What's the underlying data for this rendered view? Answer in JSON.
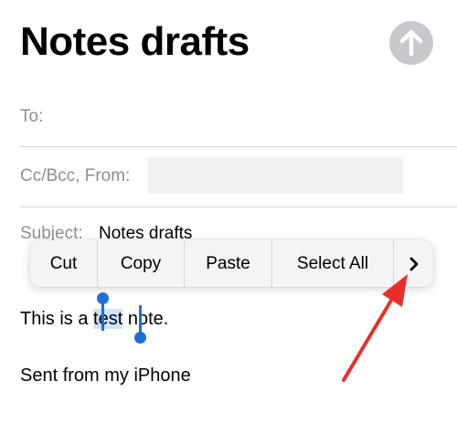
{
  "compose": {
    "title": "Notes drafts",
    "send_icon": "arrow-up-icon",
    "to_label": "To:",
    "cc_label": "Cc/Bcc, From:",
    "from_value": "",
    "subject_label": "Subject:",
    "subject_value": "Notes drafts"
  },
  "edit_menu": {
    "items": [
      "Cut",
      "Copy",
      "Paste",
      "Select All"
    ],
    "more_icon": "chevron-right-icon"
  },
  "body": {
    "text_before": "This is a ",
    "selected_word": "test",
    "text_after": " note.",
    "signature": "Sent from my iPhone"
  },
  "colors": {
    "selection": "#cfe3f9",
    "handle": "#1f6fd6",
    "annotation_arrow": "#e8302b",
    "send_button": "#c7c7cc"
  }
}
